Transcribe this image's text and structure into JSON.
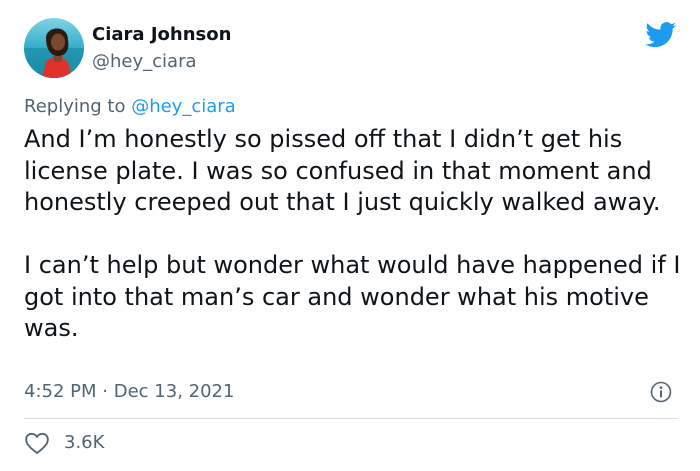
{
  "author": {
    "name": "Ciara Johnson",
    "handle": "@hey_ciara"
  },
  "icons": {
    "brand": "twitter-bird-icon",
    "info": "info-icon",
    "like": "heart-icon"
  },
  "reply": {
    "prefix": "Replying to ",
    "mention": "@hey_ciara"
  },
  "tweet": {
    "paragraphs": [
      "And I’m honestly so pissed off that I didn’t get his license plate. I was so confused in that moment and honestly creeped out that I just quickly walked away.",
      "I can’t help but wonder what would have happened if I got into that man’s car and wonder what his motive was."
    ],
    "time": "4:52 PM",
    "separator": "·",
    "date": "Dec 13, 2021"
  },
  "stats": {
    "likes": "3.6K"
  },
  "colors": {
    "brand_blue": "#1d9bf0",
    "text": "#0f1419",
    "muted": "#536471",
    "divider": "#cfd9de"
  }
}
